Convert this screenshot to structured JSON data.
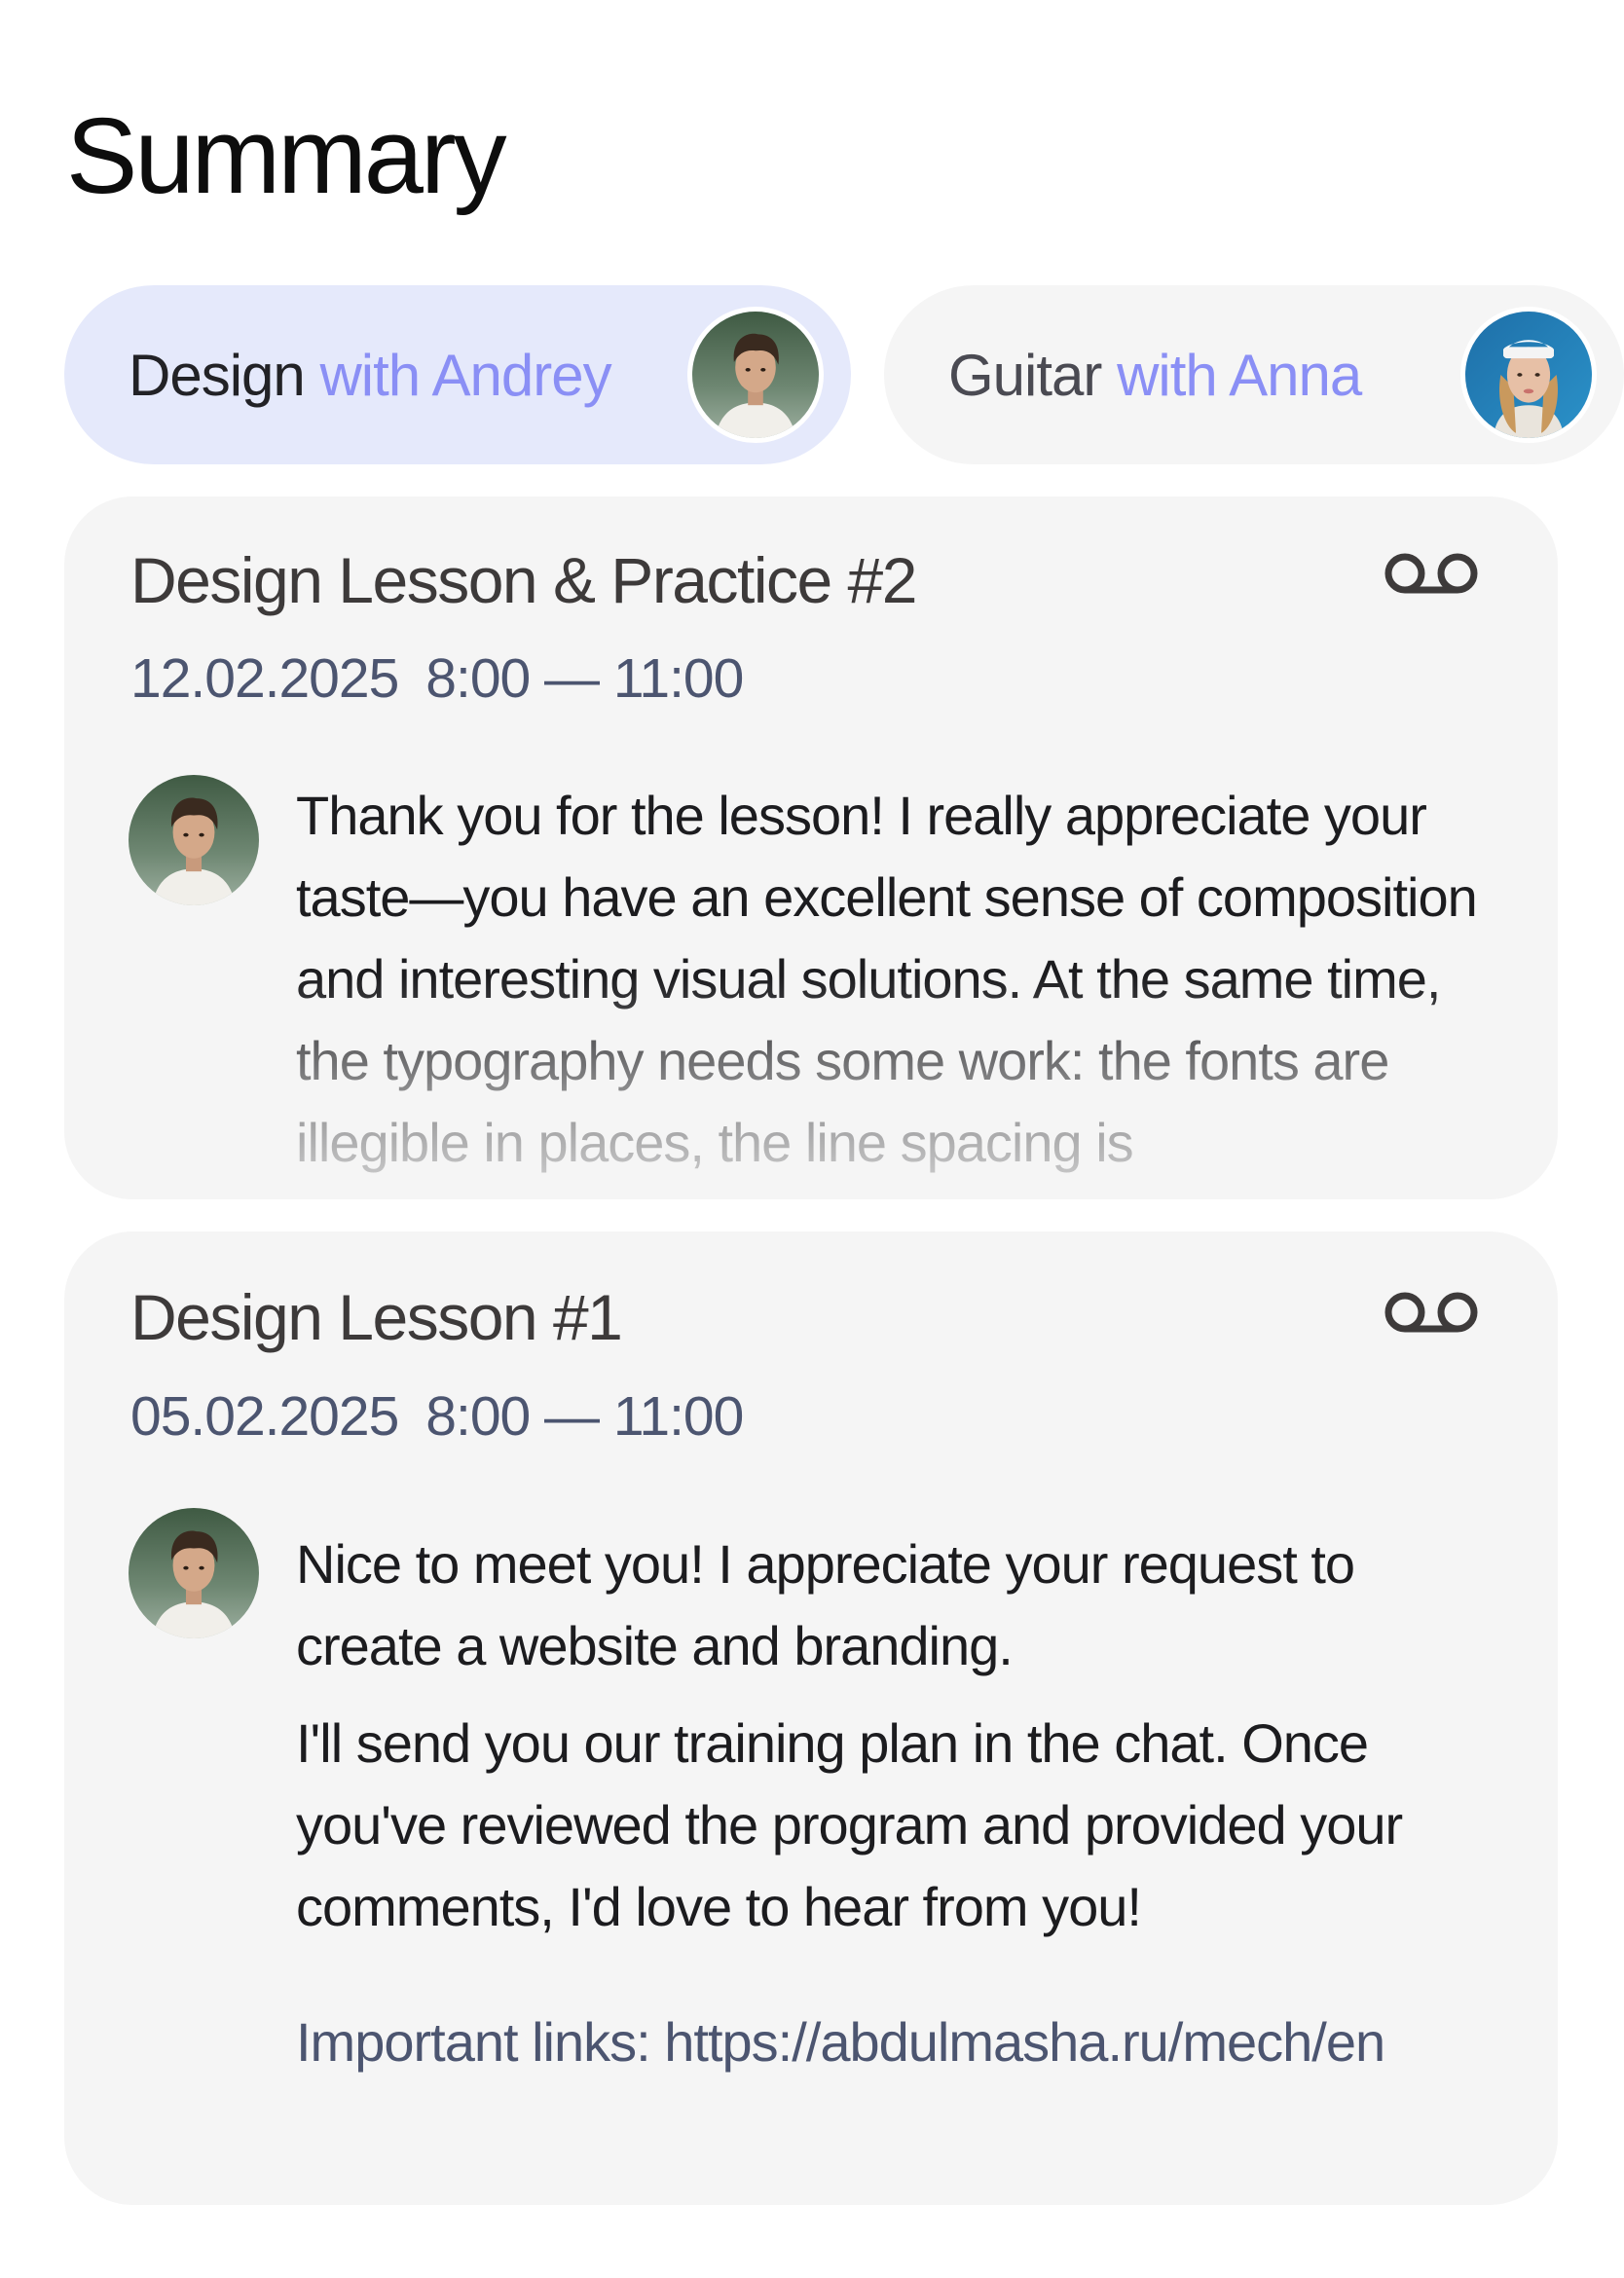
{
  "page": {
    "title": "Summary"
  },
  "tabs": [
    {
      "subject": "Design",
      "with_text": "with Andrey",
      "active": true
    },
    {
      "subject": "Guitar",
      "with_text": "with Anna",
      "active": false
    }
  ],
  "lessons": [
    {
      "title": "Design Lesson & Practice #2",
      "date": "12.02.2025",
      "time": "8:00 — 11:00",
      "icon": "voicemail-icon",
      "message_paragraphs": [
        "Thank you for the lesson! I really appreciate your taste—you have an excellent sense of composition and interesting visual solutions. At the same time, the typography needs some work: the fonts are illegible in places, the line spacing is"
      ]
    },
    {
      "title": "Design Lesson #1",
      "date": "05.02.2025",
      "time": "8:00 — 11:00",
      "icon": "voicemail-icon",
      "message_paragraphs": [
        "Nice to meet you! I appreciate your request to create a website and branding.",
        "I'll send you our training plan in the chat. Once you've reviewed the program and provided your comments, I'd love to hear from you!"
      ],
      "links_label": "Important links:",
      "links_url": "https://abdulmasha.ru/mech/en"
    }
  ],
  "colors": {
    "active_tab_bg": "#e5e9fb",
    "accent": "#8a8ff5",
    "card_bg": "#f5f5f5",
    "muted_text": "#4c5570"
  }
}
